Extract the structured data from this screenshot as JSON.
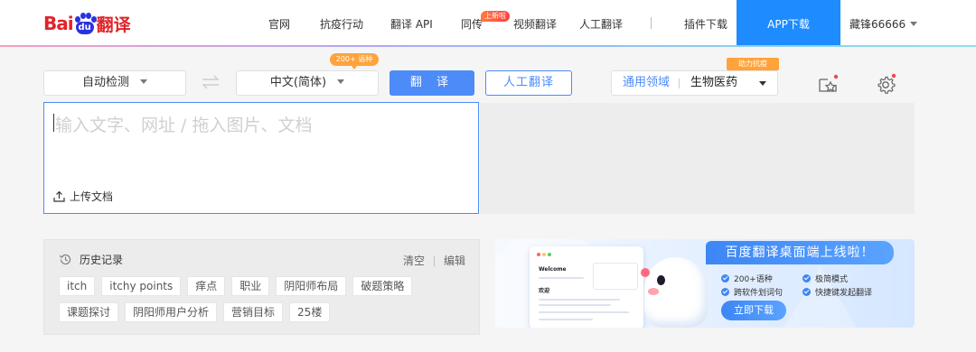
{
  "header": {
    "logo": {
      "text_bai": "Bai",
      "text_du": "du",
      "text_fanyi": "翻译"
    },
    "nav": [
      {
        "label": "官网"
      },
      {
        "label": "抗疫行动"
      },
      {
        "label": "翻译 API"
      },
      {
        "label": "同传"
      },
      {
        "label": "视频翻译"
      },
      {
        "label": "人工翻译"
      },
      {
        "label": "插件下载"
      }
    ],
    "new_badge": "上新啦",
    "app_download": "APP下载",
    "user": "藏锋66666"
  },
  "toolbar": {
    "source_lang": "自动检测",
    "target_lang": "中文(简体)",
    "languages_tip": "200+ 语种",
    "translate_button": "翻 译",
    "human_translate_button": "人工翻译",
    "domain_label": "通用领域",
    "domain_value": "生物医药",
    "assist_tip": "助力抗疫"
  },
  "input": {
    "placeholder": "输入文字、网址 / 拖入图片、文档",
    "upload_label": "上传文档"
  },
  "history": {
    "title": "历史记录",
    "clear": "清空",
    "edit": "编辑",
    "tags": [
      [
        "itch",
        "itchy points",
        "痒点",
        "职业",
        "阴阳师布局",
        "破题策略"
      ],
      [
        "课题探讨",
        "阴阳师用户分析",
        "营销目标",
        "25楼"
      ]
    ]
  },
  "banner": {
    "title": "百度翻译桌面端上线啦！",
    "features": [
      "200+语种",
      "极简模式",
      "跨软件划词句",
      "快捷键发起翻译"
    ],
    "button": "立即下载",
    "mock_welcome": "Welcome",
    "mock_heading": "欢迎"
  },
  "colors": {
    "brand_red": "#e1242a",
    "brand_blue": "#2932e1",
    "accent_blue": "#4d8bf8",
    "app_button": "#1e8bff",
    "tip_orange": "#ffa33a"
  },
  "icons": {
    "swap": "swap-arrows-icon",
    "favorites": "favorites-star-icon",
    "settings": "gear-icon",
    "upload": "upload-icon",
    "history": "clock-history-icon"
  }
}
